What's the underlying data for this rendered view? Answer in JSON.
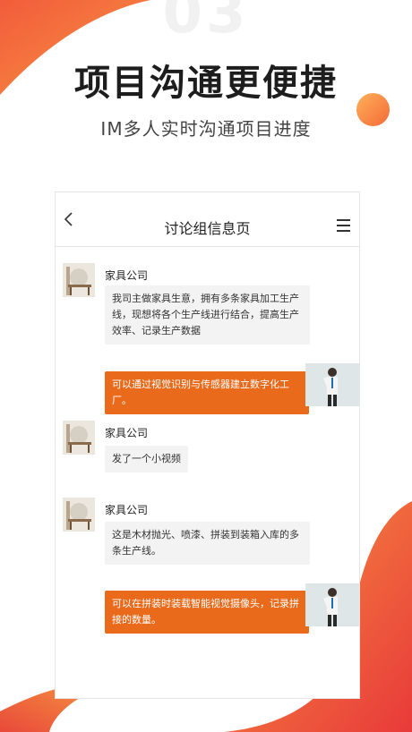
{
  "hero": {
    "number": "03",
    "title": "项目沟通更便捷",
    "subtitle": "IM多人实时沟通项目进度"
  },
  "nav": {
    "back_icon": "chevron-left-icon",
    "title": "讨论组信息页",
    "menu_icon": "hamburger-menu-icon"
  },
  "messages": [
    {
      "direction": "in",
      "sender": "家具公司",
      "text": "我司主做家具生意，拥有多条家具加工生产线，现想将各个生产线进行结合，提高生产效率、记录生产数据"
    },
    {
      "direction": "out",
      "text": "可以通过视觉识别与传感器建立数字化工厂。"
    },
    {
      "direction": "in",
      "sender": "家具公司",
      "text": "发了一个小视频"
    },
    {
      "direction": "in",
      "sender": "家具公司",
      "text": "这是木材抛光、喷漆、拼装到装箱入库的多条生产线。"
    },
    {
      "direction": "out",
      "text": "可以在拼装时装载智能视觉摄像头，记录拼接的数量。"
    }
  ],
  "colors": {
    "accent": "#ea6a1b",
    "gradient_start": "#f79440",
    "gradient_end": "#e83a3a"
  }
}
